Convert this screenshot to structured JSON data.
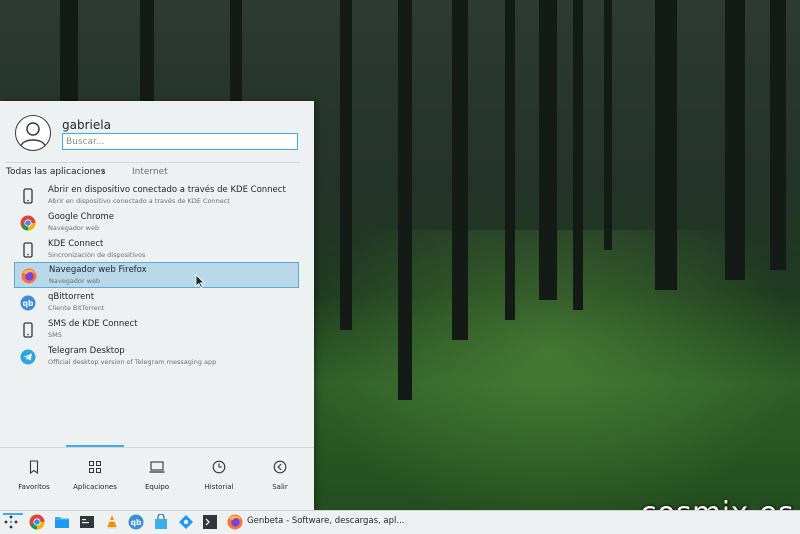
{
  "user": {
    "name": "gabriela"
  },
  "search": {
    "placeholder": "Buscar..."
  },
  "breadcrumb": {
    "root": "Todas las aplicaciones",
    "separator": "›",
    "current": "Internet"
  },
  "apps": [
    {
      "name": "Abrir en dispositivo conectado a través de KDE Connect",
      "desc": "Abrir en dispositivo conectado a través de KDE Connect",
      "icon": "phone-icon"
    },
    {
      "name": "Google Chrome",
      "desc": "Navegador web",
      "icon": "chrome-icon"
    },
    {
      "name": "KDE Connect",
      "desc": "Sincronización de dispositivos",
      "icon": "phone-icon"
    },
    {
      "name": "Navegador web Firefox",
      "desc": "Navegador web",
      "icon": "firefox-icon",
      "selected": true
    },
    {
      "name": "qBittorrent",
      "desc": "Cliente BitTorrent",
      "icon": "qbittorrent-icon"
    },
    {
      "name": "SMS de KDE Connect",
      "desc": "SMS",
      "icon": "phone-icon"
    },
    {
      "name": "Telegram Desktop",
      "desc": "Official desktop version of Telegram messaging app",
      "icon": "telegram-icon"
    }
  ],
  "tabs": [
    {
      "label": "Favoritos",
      "icon": "bookmark-icon"
    },
    {
      "label": "Aplicaciones",
      "icon": "grid-icon",
      "active": true
    },
    {
      "label": "Equipo",
      "icon": "laptop-icon"
    },
    {
      "label": "Historial",
      "icon": "clock-icon"
    },
    {
      "label": "Salir",
      "icon": "back-icon"
    }
  ],
  "taskbar": {
    "launchers": [
      "kickoff-icon",
      "chrome-icon",
      "folder-icon",
      "terminal-monitor-icon",
      "vlc-icon",
      "qbittorrent-icon",
      "bag-icon",
      "kdeconnect-icon",
      "terminal-icon"
    ],
    "task_title": "Genbeta - Software, descargas, apl..."
  },
  "watermark": "cosmix.es",
  "colors": {
    "accent": "#3daee9",
    "selection": "#b9d9ea",
    "panel": "#eef1f1"
  }
}
